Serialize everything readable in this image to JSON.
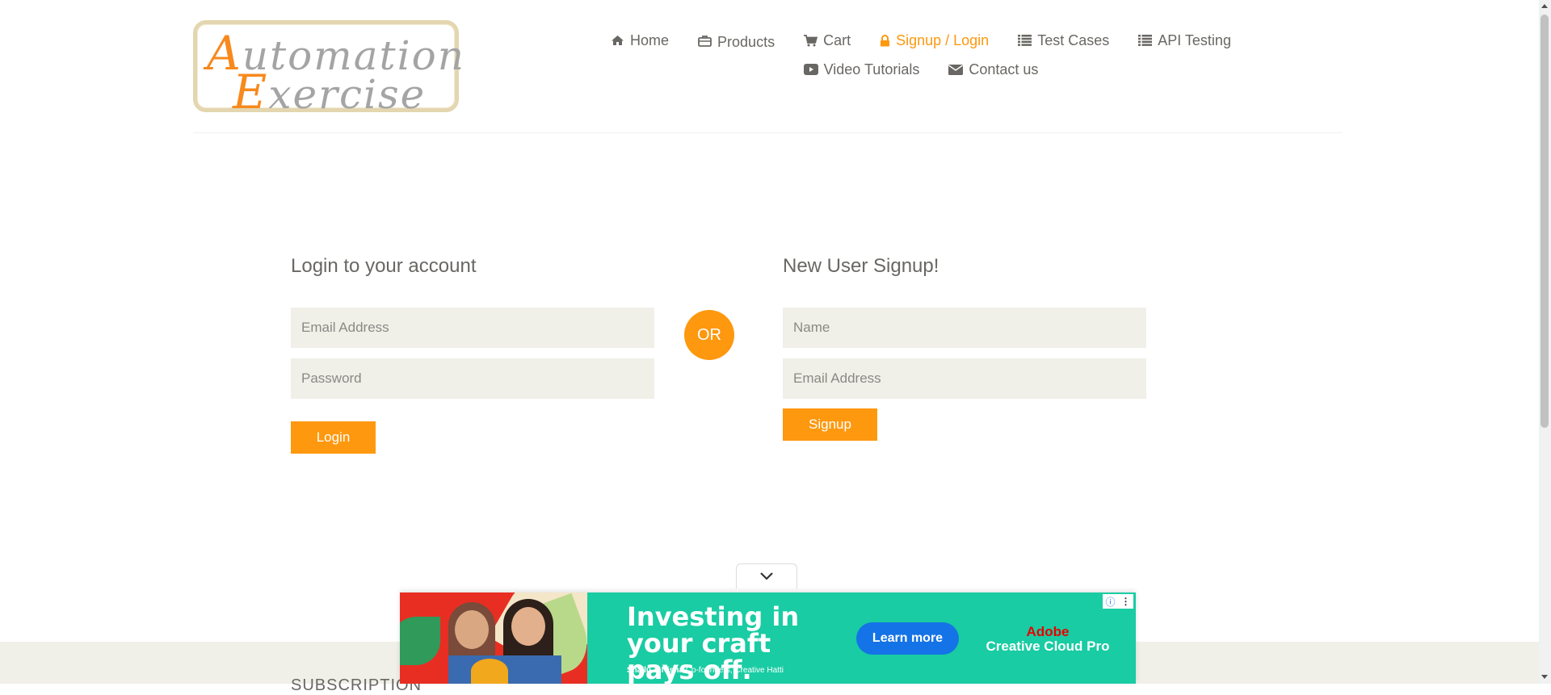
{
  "logo": {
    "line1_cap": "A",
    "line1_rest": "utomation",
    "line2_cap": "E",
    "line2_rest": "xercise"
  },
  "nav": {
    "items": [
      {
        "label": "Home",
        "icon": "home-icon"
      },
      {
        "label": "Products",
        "icon": "briefcase-icon"
      },
      {
        "label": "Cart",
        "icon": "cart-icon"
      },
      {
        "label": "Signup / Login",
        "icon": "lock-icon",
        "active": true
      },
      {
        "label": "Test Cases",
        "icon": "list-icon"
      },
      {
        "label": "API Testing",
        "icon": "list-icon"
      },
      {
        "label": "Video Tutorials",
        "icon": "youtube-icon"
      },
      {
        "label": "Contact us",
        "icon": "envelope-icon"
      }
    ]
  },
  "login": {
    "title": "Login to your account",
    "email_placeholder": "Email Address",
    "password_placeholder": "Password",
    "button": "Login"
  },
  "or_label": "OR",
  "signup": {
    "title": "New User Signup!",
    "name_placeholder": "Name",
    "email_placeholder": "Email Address",
    "button": "Signup"
  },
  "footer": {
    "subscription_title": "SUBSCRIPTION"
  },
  "ad": {
    "headline": "Investing in your craft pays off.",
    "sub_names": "Shallu & Nisha",
    "sub_role": "Co-founders, Creative Hatti",
    "cta": "Learn more",
    "brand_line1": "Adobe",
    "brand_line2": "Creative Cloud Pro"
  },
  "colors": {
    "accent": "#fe980f",
    "field_bg": "#f0f0e9",
    "text": "#696763",
    "ad_bg": "#19cca3"
  }
}
